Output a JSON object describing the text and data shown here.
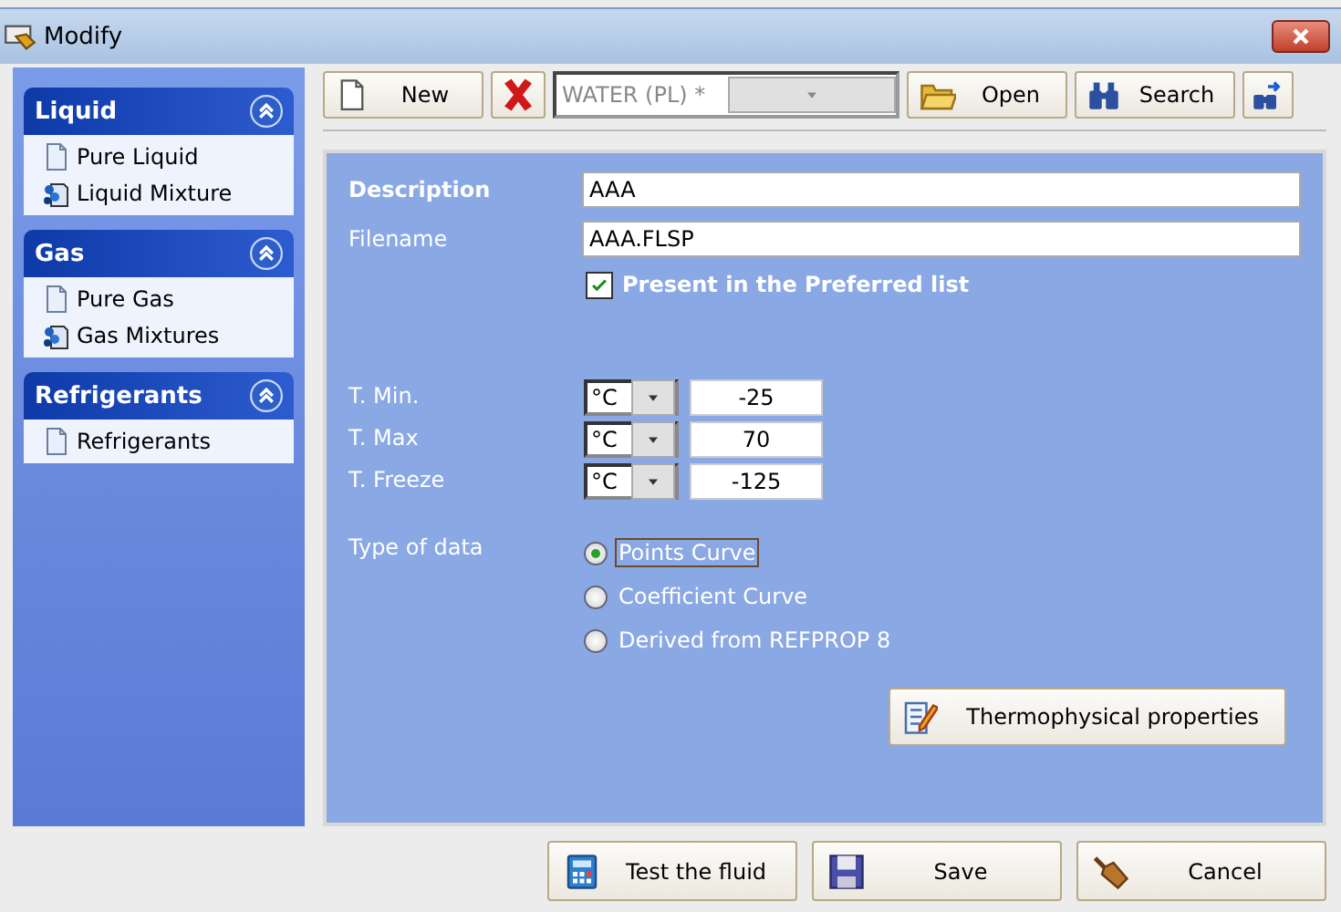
{
  "window": {
    "title": "Modify"
  },
  "sidebar": {
    "groups": [
      {
        "title": "Liquid",
        "expanded": true,
        "items": [
          {
            "label": "Pure Liquid",
            "kind": "document"
          },
          {
            "label": "Liquid Mixture",
            "kind": "mixture"
          }
        ]
      },
      {
        "title": "Gas",
        "expanded": true,
        "items": [
          {
            "label": "Pure Gas",
            "kind": "document"
          },
          {
            "label": "Gas Mixtures",
            "kind": "mixture"
          }
        ]
      },
      {
        "title": "Refrigerants",
        "expanded": true,
        "items": [
          {
            "label": "Refrigerants",
            "kind": "document"
          }
        ]
      }
    ]
  },
  "toolbar": [
    {
      "kind": "new",
      "label": "New"
    },
    {
      "kind": "delete"
    },
    {
      "kind": "combo",
      "value": "WATER (PL) *"
    },
    {
      "kind": "open",
      "label": "Open"
    },
    {
      "kind": "search",
      "label": "Search"
    },
    {
      "kind": "search-next"
    }
  ],
  "form": {
    "description": {
      "label": "Description",
      "value": "AAA"
    },
    "filename": {
      "label": "Filename",
      "value": "AAA.FLSP"
    },
    "preferred": {
      "label": "Present in the Preferred list",
      "checked": true
    },
    "temperatures": [
      {
        "label": "T. Min.",
        "unit": "°C",
        "value": "-25"
      },
      {
        "label": "T. Max",
        "unit": "°C",
        "value": "70"
      },
      {
        "label": "T. Freeze",
        "unit": "°C",
        "value": "-125"
      }
    ],
    "type_of_data": {
      "label": "Type of data",
      "options": [
        {
          "label": "Points Curve",
          "selected": true
        },
        {
          "label": "Coefficient Curve",
          "selected": false
        },
        {
          "label": "Derived from REFPROP 8",
          "selected": false
        }
      ]
    },
    "thermo_button": {
      "label": "Thermophysical properties"
    }
  },
  "footer": [
    {
      "kind": "calculator",
      "label": "Test the fluid"
    },
    {
      "kind": "save",
      "label": "Save"
    },
    {
      "kind": "cancel",
      "label": "Cancel"
    }
  ]
}
